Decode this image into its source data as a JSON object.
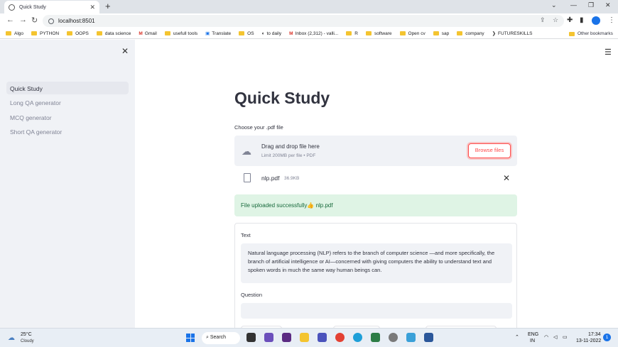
{
  "browser": {
    "tab_title": "Quick Study",
    "url": "localhost:8501",
    "bookmarks": [
      "Algo",
      "PYTHON",
      "OOPS",
      "data science",
      "Gmail",
      "usefull tools",
      "Translate",
      "OS",
      "to daily",
      "Inbox (2,312) - valli...",
      "R",
      "software",
      "Open cv",
      "sap",
      "company",
      "FUTURESKILLS"
    ],
    "other_bookmarks": "Other bookmarks"
  },
  "sidebar": {
    "items": [
      {
        "label": "Quick Study",
        "active": true
      },
      {
        "label": "Long QA generator",
        "active": false
      },
      {
        "label": "MCQ generator",
        "active": false
      },
      {
        "label": "Short QA generator",
        "active": false
      }
    ]
  },
  "main": {
    "title": "Quick Study",
    "upload_label": "Choose your .pdf file",
    "dropzone_title": "Drag and drop file here",
    "dropzone_sub": "Limit 200MB per file • PDF",
    "browse_label": "Browse files",
    "file_name": "nlp.pdf",
    "file_size": "36.9KB",
    "success_message": "File uploaded successfully👍 nlp.pdf",
    "text_label": "Text",
    "text_value": "Natural language processing (NLP) refers to the branch of computer science —and more specifically, the branch of  artificial  intelligence  or AI—concerned with giving computers the ability to understand text and spoken words in much the same way human beings can.",
    "question_label": "Question",
    "question_value": ""
  },
  "taskbar": {
    "temperature": "25°C",
    "weather": "Cloudy",
    "search_label": "Search",
    "lang1": "ENG",
    "lang2": "IN",
    "time": "17:34",
    "date": "13-11-2022",
    "notifications": "1"
  },
  "colors": {
    "accent": "#ff4b4b",
    "sidebar_bg": "#f0f2f6",
    "success_bg": "#dff4e5",
    "success_text": "#17693b"
  }
}
